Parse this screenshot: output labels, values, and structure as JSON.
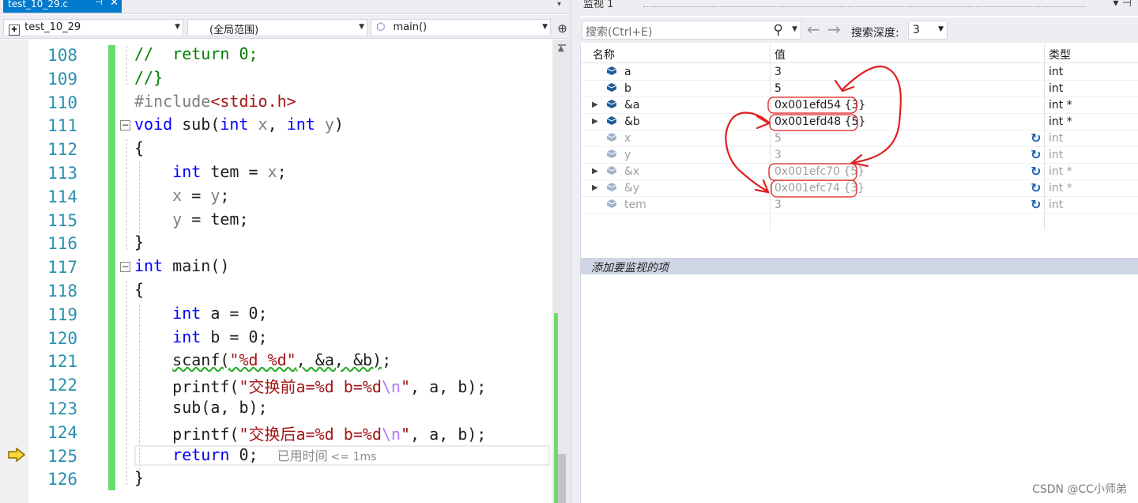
{
  "editor": {
    "tab_label": "test_10_29.c",
    "tab_pin": "⊣",
    "tab_close": "✕",
    "project_combo": "test_10_29",
    "scope_combo": "(全局范围)",
    "function_combo": "main()",
    "line_numbers": [
      "108",
      "109",
      "110",
      "111",
      "112",
      "113",
      "114",
      "115",
      "116",
      "117",
      "118",
      "119",
      "120",
      "121",
      "122",
      "123",
      "124",
      "125",
      "126"
    ],
    "elapsed_label": "已用时间",
    "elapsed_value": "<= 1ms"
  },
  "code": [
    {
      "line": "108",
      "parts": [
        {
          "t": "//  return 0;",
          "c": "cm"
        }
      ]
    },
    {
      "line": "109",
      "parts": [
        {
          "t": "//}",
          "c": "cm"
        }
      ]
    },
    {
      "line": "110",
      "parts": [
        {
          "t": "#include",
          "c": "pp"
        },
        {
          "t": "<stdio.h>",
          "c": "st"
        }
      ]
    },
    {
      "line": "111",
      "parts": [
        {
          "t": "void",
          "c": "kw"
        },
        {
          "t": " sub(",
          "c": ""
        },
        {
          "t": "int",
          "c": "kw"
        },
        {
          "t": " x",
          "c": "pa"
        },
        {
          "t": ", ",
          "c": ""
        },
        {
          "t": "int",
          "c": "kw"
        },
        {
          "t": " y",
          "c": "pa"
        },
        {
          "t": ")",
          "c": ""
        }
      ]
    },
    {
      "line": "112",
      "parts": [
        {
          "t": "{",
          "c": ""
        }
      ]
    },
    {
      "line": "113",
      "parts": [
        {
          "t": "    ",
          "c": ""
        },
        {
          "t": "int",
          "c": "kw"
        },
        {
          "t": " tem = ",
          "c": ""
        },
        {
          "t": "x",
          "c": "pa"
        },
        {
          "t": ";",
          "c": ""
        }
      ]
    },
    {
      "line": "114",
      "parts": [
        {
          "t": "    ",
          "c": ""
        },
        {
          "t": "x",
          "c": "pa"
        },
        {
          "t": " = ",
          "c": ""
        },
        {
          "t": "y",
          "c": "pa"
        },
        {
          "t": ";",
          "c": ""
        }
      ]
    },
    {
      "line": "115",
      "parts": [
        {
          "t": "    ",
          "c": ""
        },
        {
          "t": "y",
          "c": "pa"
        },
        {
          "t": " = tem;",
          "c": ""
        }
      ]
    },
    {
      "line": "116",
      "parts": [
        {
          "t": "}",
          "c": ""
        }
      ]
    },
    {
      "line": "117",
      "parts": [
        {
          "t": "int",
          "c": "kw"
        },
        {
          "t": " main()",
          "c": ""
        }
      ]
    },
    {
      "line": "118",
      "parts": [
        {
          "t": "{",
          "c": ""
        }
      ]
    },
    {
      "line": "119",
      "parts": [
        {
          "t": "    ",
          "c": ""
        },
        {
          "t": "int",
          "c": "kw"
        },
        {
          "t": " a = 0;",
          "c": ""
        }
      ]
    },
    {
      "line": "120",
      "parts": [
        {
          "t": "    ",
          "c": ""
        },
        {
          "t": "int",
          "c": "kw"
        },
        {
          "t": " b = 0;",
          "c": ""
        }
      ]
    },
    {
      "line": "121",
      "parts": [
        {
          "t": "    ",
          "c": ""
        },
        {
          "t": "scanf(",
          "c": "squig"
        },
        {
          "t": "\"%d %d\"",
          "c": "squig st"
        },
        {
          "t": ", &a, &b)",
          "c": "squig"
        },
        {
          "t": ";",
          "c": ""
        }
      ]
    },
    {
      "line": "122",
      "parts": [
        {
          "t": "    printf(",
          "c": ""
        },
        {
          "t": "\"交换前a=%d b=%d",
          "c": "st"
        },
        {
          "t": "\\n",
          "c": "es"
        },
        {
          "t": "\"",
          "c": "st"
        },
        {
          "t": ", a, b);",
          "c": ""
        }
      ]
    },
    {
      "line": "123",
      "parts": [
        {
          "t": "    sub(a, b);",
          "c": ""
        }
      ]
    },
    {
      "line": "124",
      "parts": [
        {
          "t": "    printf(",
          "c": ""
        },
        {
          "t": "\"交换后a=%d b=%d",
          "c": "st"
        },
        {
          "t": "\\n",
          "c": "es"
        },
        {
          "t": "\"",
          "c": "st"
        },
        {
          "t": ", a, b);",
          "c": ""
        }
      ]
    },
    {
      "line": "125",
      "parts": [
        {
          "t": "    ",
          "c": ""
        },
        {
          "t": "return",
          "c": "kw"
        },
        {
          "t": " 0;  ",
          "c": ""
        }
      ]
    },
    {
      "line": "126",
      "parts": [
        {
          "t": "}",
          "c": ""
        }
      ]
    }
  ],
  "watch": {
    "title": "监视 1",
    "title_controls": "▾ ⊣",
    "search_placeholder": "搜索(Ctrl+E)",
    "search_depth_label": "搜索深度:",
    "search_depth_value": "3",
    "columns": {
      "name": "名称",
      "value": "值",
      "type": "类型"
    },
    "rows": [
      {
        "name": "a",
        "value": "3",
        "type": "int",
        "expandable": false,
        "stale": false
      },
      {
        "name": "b",
        "value": "5",
        "type": "int",
        "expandable": false,
        "stale": false
      },
      {
        "name": "&a",
        "value": "0x001efd54 {3}",
        "type": "int *",
        "expandable": true,
        "stale": false
      },
      {
        "name": "&b",
        "value": "0x001efd48 {5}",
        "type": "int *",
        "expandable": true,
        "stale": false
      },
      {
        "name": "x",
        "value": "5",
        "type": "int",
        "expandable": false,
        "stale": true
      },
      {
        "name": "y",
        "value": "3",
        "type": "int",
        "expandable": false,
        "stale": true
      },
      {
        "name": "&x",
        "value": "0x001efc70 {5}",
        "type": "int *",
        "expandable": true,
        "stale": true
      },
      {
        "name": "&y",
        "value": "0x001efc74 {3}",
        "type": "int *",
        "expandable": true,
        "stale": true
      },
      {
        "name": "tem",
        "value": "3",
        "type": "int",
        "expandable": false,
        "stale": true
      }
    ],
    "add_item_placeholder": "添加要监视的项"
  },
  "watermark": "CSDN @CC小师弟",
  "colors": {
    "accent": "#007acc",
    "changebar": "#6cdb6c",
    "annotation": "#e02020",
    "keyword": "#0000ff",
    "comment": "#008000",
    "string": "#a31515"
  }
}
